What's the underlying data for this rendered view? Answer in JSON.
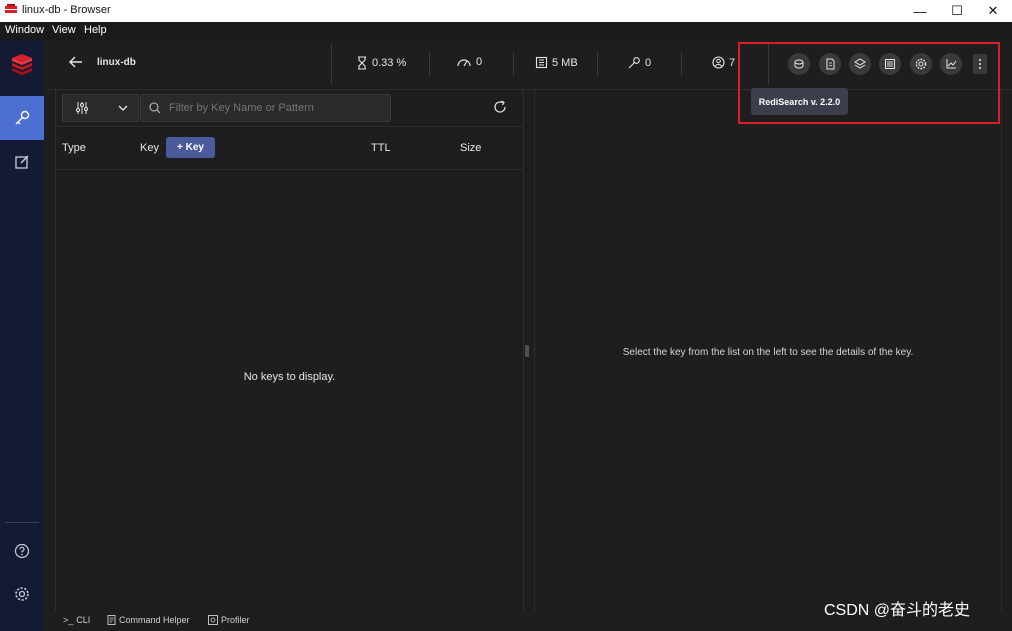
{
  "window": {
    "title": "linux-db - Browser",
    "minimize": "—",
    "maximize": "☐",
    "close": "✕"
  },
  "menu": [
    "Window",
    "View",
    "Help"
  ],
  "header": {
    "db_name": "linux-db",
    "stats": {
      "cpu": "0.33 %",
      "ops": "0",
      "memory": "5 MB",
      "keys": "0",
      "clients": "7"
    },
    "module_icons": [
      "redisearch-icon",
      "redisjson-icon",
      "redisgraph-icon",
      "redistimeseries-icon",
      "redisgears-icon",
      "redisbloom-icon",
      "more-icon"
    ],
    "tooltip": "RediSearch v. 2.2.0"
  },
  "browser": {
    "search_placeholder": "Filter by Key Name or Pattern",
    "columns": {
      "type": "Type",
      "key": "Key",
      "ttl": "TTL",
      "size": "Size"
    },
    "add_key_label": "+ Key",
    "empty_message": "No keys to display.",
    "details_message": "Select the key from the list on the left to see the details of the key."
  },
  "bottom": {
    "cli": "CLI",
    "cli_prefix": ">_",
    "command_helper": "Command Helper",
    "profiler": "Profiler"
  },
  "watermark": "CSDN @奋斗的老史",
  "colors": {
    "accent": "#4d6fd1",
    "nav_bg": "#141a33",
    "highlight": "#d61f26",
    "add_key": "#4a5a9a"
  }
}
